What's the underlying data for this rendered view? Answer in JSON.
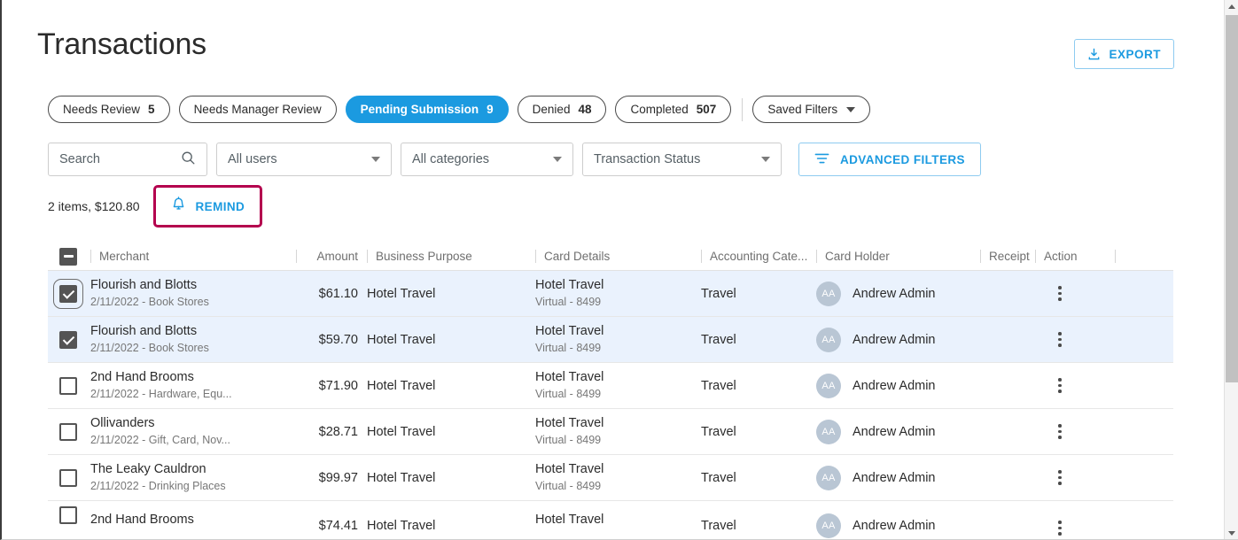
{
  "header": {
    "title": "Transactions",
    "export_label": "EXPORT",
    "export_icon": "download-icon"
  },
  "chips": [
    {
      "label": "Needs Review",
      "count": "5",
      "active": false
    },
    {
      "label": "Needs Manager Review",
      "count": "",
      "active": false
    },
    {
      "label": "Pending Submission",
      "count": "9",
      "active": true
    },
    {
      "label": "Denied",
      "count": "48",
      "active": false
    },
    {
      "label": "Completed",
      "count": "507",
      "active": false
    }
  ],
  "saved_filters": {
    "label": "Saved Filters",
    "icon": "chevron-down-icon"
  },
  "filters": {
    "search_placeholder": "Search",
    "search_value": "",
    "search_icon": "search-icon",
    "users_value": "All users",
    "categories_value": "All categories",
    "status_value": "Transaction Status",
    "advanced_label": "ADVANCED FILTERS",
    "advanced_icon": "filter-icon"
  },
  "summary": {
    "text": "2 items, $120.80",
    "remind_label": "REMIND",
    "remind_icon": "bell-icon",
    "highlight_color": "#b4004e"
  },
  "table": {
    "select_all_state": "indeterminate",
    "columns": {
      "merchant": "Merchant",
      "amount": "Amount",
      "business_purpose": "Business Purpose",
      "card_details": "Card Details",
      "accounting_category": "Accounting Cate...",
      "card_holder": "Card Holder",
      "receipt": "Receipt",
      "action": "Action"
    },
    "rows": [
      {
        "selected": true,
        "focused": true,
        "merchant": "Flourish and Blotts",
        "meta": "2/11/2022 - Book Stores",
        "amount": "$61.10",
        "business_purpose": "Hotel Travel",
        "card_name": "Hotel Travel",
        "card_sub": "Virtual - 8499",
        "accounting_category": "Travel",
        "avatar_initials": "AA",
        "card_holder": "Andrew Admin"
      },
      {
        "selected": true,
        "focused": false,
        "merchant": "Flourish and Blotts",
        "meta": "2/11/2022 - Book Stores",
        "amount": "$59.70",
        "business_purpose": "Hotel Travel",
        "card_name": "Hotel Travel",
        "card_sub": "Virtual - 8499",
        "accounting_category": "Travel",
        "avatar_initials": "AA",
        "card_holder": "Andrew Admin"
      },
      {
        "selected": false,
        "focused": false,
        "merchant": "2nd Hand Brooms",
        "meta": "2/11/2022 - Hardware, Equ...",
        "amount": "$71.90",
        "business_purpose": "Hotel Travel",
        "card_name": "Hotel Travel",
        "card_sub": "Virtual - 8499",
        "accounting_category": "Travel",
        "avatar_initials": "AA",
        "card_holder": "Andrew Admin"
      },
      {
        "selected": false,
        "focused": false,
        "merchant": "Ollivanders",
        "meta": "2/11/2022 - Gift, Card, Nov...",
        "amount": "$28.71",
        "business_purpose": "Hotel Travel",
        "card_name": "Hotel Travel",
        "card_sub": "Virtual - 8499",
        "accounting_category": "Travel",
        "avatar_initials": "AA",
        "card_holder": "Andrew Admin"
      },
      {
        "selected": false,
        "focused": false,
        "merchant": "The Leaky Cauldron",
        "meta": "2/11/2022 - Drinking Places",
        "amount": "$99.97",
        "business_purpose": "Hotel Travel",
        "card_name": "Hotel Travel",
        "card_sub": "Virtual - 8499",
        "accounting_category": "Travel",
        "avatar_initials": "AA",
        "card_holder": "Andrew Admin"
      },
      {
        "selected": false,
        "focused": false,
        "merchant": "2nd Hand Brooms",
        "meta": "",
        "amount": "$74.41",
        "business_purpose": "Hotel Travel",
        "card_name": "Hotel Travel",
        "card_sub": "",
        "accounting_category": "Travel",
        "avatar_initials": "AA",
        "card_holder": "Andrew Admin"
      }
    ]
  },
  "scrollbar": {
    "up_icon": "triangle-up-icon",
    "down_icon": "triangle-down-icon"
  },
  "colors": {
    "accent": "#1b9ae0",
    "selected_row": "#eaf2fd",
    "highlight": "#b4004e"
  }
}
